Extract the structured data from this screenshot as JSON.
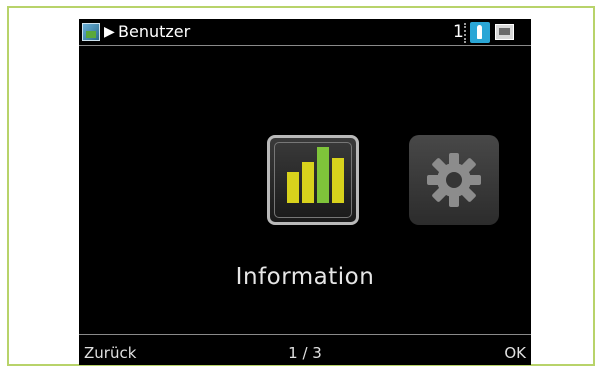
{
  "header": {
    "app_icon": "app-icon",
    "arrow": "▶",
    "title": "Benutzer",
    "count": "1",
    "touch_icon": "touch-hand-icon",
    "display_icon": "display-icon"
  },
  "menu": {
    "items": [
      {
        "icon": "bar-chart-icon",
        "label": "Information",
        "selected": true
      },
      {
        "icon": "gear-icon",
        "selected": false
      }
    ]
  },
  "footer": {
    "back_label": "Zurück",
    "page_indicator": "1 / 3",
    "ok_label": "OK"
  },
  "colors": {
    "frame_border": "#b8d36a",
    "bar_yellow": "#d8d21c",
    "bar_green": "#7fc43a",
    "touch_blue": "#2aa6d6"
  }
}
